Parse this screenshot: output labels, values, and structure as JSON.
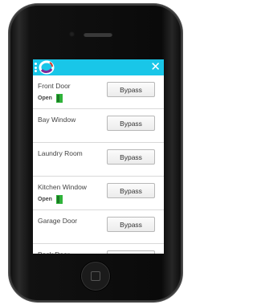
{
  "app": {
    "header_color": "#19c6e8",
    "menu_icon": "kebab-menu-icon",
    "logo_icon": "app-logo-icon",
    "close_icon": "close-icon",
    "close_symbol": "✕"
  },
  "zones": [
    {
      "name": "Front Door",
      "status": "Open",
      "button": "Bypass"
    },
    {
      "name": "Bay Window",
      "status": "",
      "button": "Bypass"
    },
    {
      "name": "Laundry Room",
      "status": "",
      "button": "Bypass"
    },
    {
      "name": "Kitchen Window",
      "status": "Open",
      "button": "Bypass"
    },
    {
      "name": "Garage Door",
      "status": "",
      "button": "Bypass"
    },
    {
      "name": "Back Door",
      "status": "",
      "button": "Bypass"
    }
  ],
  "colors": {
    "open_status": "#2fb33a"
  }
}
